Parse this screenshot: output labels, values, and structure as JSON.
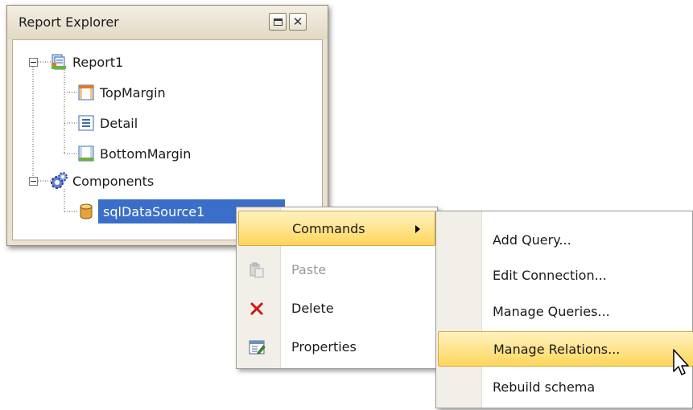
{
  "explorer": {
    "title": "Report Explorer",
    "buttons": {
      "maximize_icon": "maximize-icon",
      "close_icon": "close-icon"
    },
    "tree": {
      "report": "Report1",
      "bands": [
        "TopMargin",
        "Detail",
        "BottomMargin"
      ],
      "components": "Components",
      "datasource": "sqlDataSource1"
    }
  },
  "context_menu": {
    "items": [
      {
        "label": "Commands",
        "has_submenu": true,
        "highlighted": true
      },
      {
        "label": "Paste",
        "icon": "paste-icon",
        "disabled": true
      },
      {
        "label": "Delete",
        "icon": "delete-icon"
      },
      {
        "label": "Properties",
        "icon": "properties-icon"
      }
    ]
  },
  "submenu": {
    "items": [
      {
        "label": "Add Query..."
      },
      {
        "label": "Edit Connection..."
      },
      {
        "label": "Manage Queries..."
      },
      {
        "label": "Manage Relations...",
        "highlighted": true
      },
      {
        "label": "Rebuild schema"
      }
    ]
  },
  "colors": {
    "selection": "#3a6ec8",
    "menu_highlight": "#ffd65c",
    "panel_background": "#e9e2d2"
  }
}
